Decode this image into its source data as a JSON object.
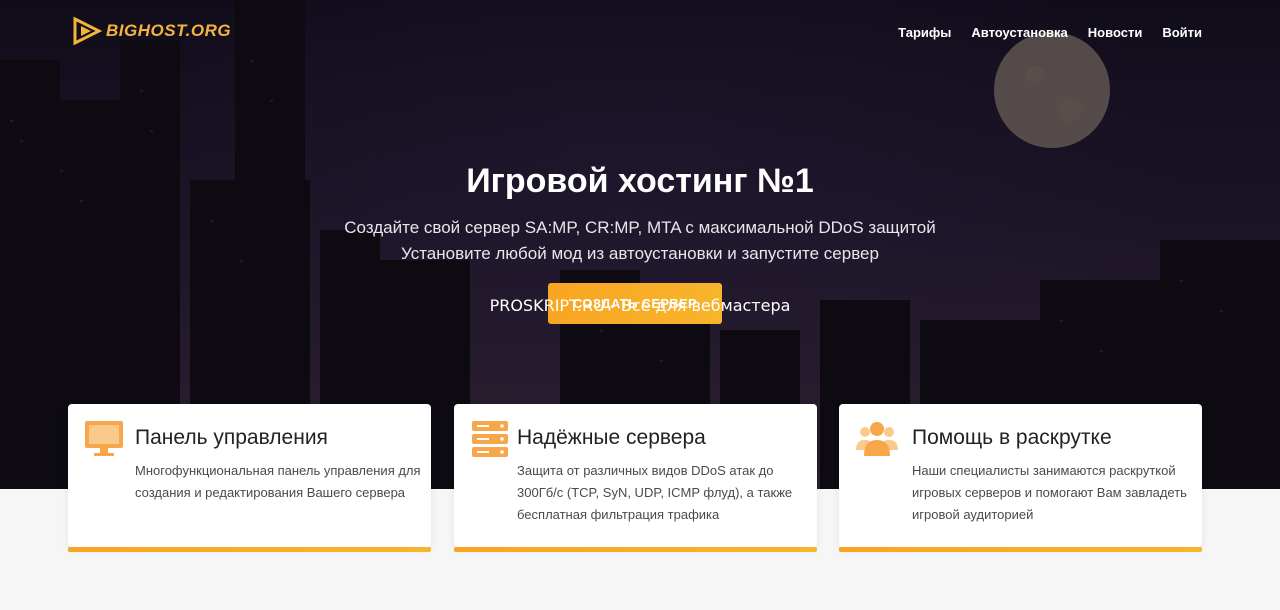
{
  "header": {
    "logo_text": "BIGHOST.ORG",
    "nav": [
      "Тарифы",
      "Автоустановка",
      "Новости",
      "Войти"
    ]
  },
  "hero": {
    "title": "Игровой хостинг №1",
    "subtitle_1": "Создайте свой сервер SA:MP, CR:MP, MTA с максимальной DDoS защитой",
    "subtitle_2": "Установите любой мод из автоустановки и запустите сервер",
    "cta_label": "СОЗДАТЬ СЕРВЕР",
    "watermark": "PROSKRIPT.RU - Все для вебмастера"
  },
  "features": [
    {
      "icon": "monitor-icon",
      "title": "Панель управления",
      "text": "Многофункциональная панель управления для создания и редактирования Вашего сервера"
    },
    {
      "icon": "server-icon",
      "title": "Надёжные сервера",
      "text": "Защита от различных видов DDoS атак до 300Гб/с (TCP, SyN, UDP, ICMP флуд), а также бесплатная фильтрация трафика"
    },
    {
      "icon": "users-icon",
      "title": "Помощь в раскрутке",
      "text": "Наши специалисты занимаются раскруткой игровых серверов и помогают Вам завладеть игровой аудиторией"
    }
  ],
  "colors": {
    "accent": "#f9a521",
    "icon_orange": "#f7a64a",
    "logo": "#f4b43c"
  }
}
